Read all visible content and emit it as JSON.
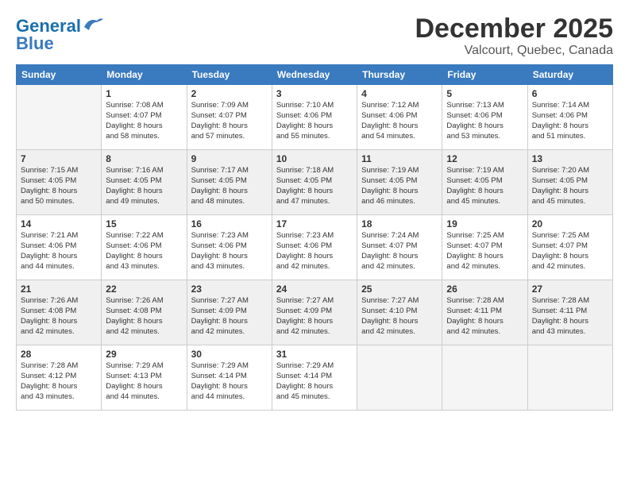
{
  "header": {
    "logo_line1": "General",
    "logo_line2": "Blue",
    "month": "December 2025",
    "location": "Valcourt, Quebec, Canada"
  },
  "days_of_week": [
    "Sunday",
    "Monday",
    "Tuesday",
    "Wednesday",
    "Thursday",
    "Friday",
    "Saturday"
  ],
  "weeks": [
    [
      {
        "day": "",
        "info": ""
      },
      {
        "day": "1",
        "info": "Sunrise: 7:08 AM\nSunset: 4:07 PM\nDaylight: 8 hours\nand 58 minutes."
      },
      {
        "day": "2",
        "info": "Sunrise: 7:09 AM\nSunset: 4:07 PM\nDaylight: 8 hours\nand 57 minutes."
      },
      {
        "day": "3",
        "info": "Sunrise: 7:10 AM\nSunset: 4:06 PM\nDaylight: 8 hours\nand 55 minutes."
      },
      {
        "day": "4",
        "info": "Sunrise: 7:12 AM\nSunset: 4:06 PM\nDaylight: 8 hours\nand 54 minutes."
      },
      {
        "day": "5",
        "info": "Sunrise: 7:13 AM\nSunset: 4:06 PM\nDaylight: 8 hours\nand 53 minutes."
      },
      {
        "day": "6",
        "info": "Sunrise: 7:14 AM\nSunset: 4:06 PM\nDaylight: 8 hours\nand 51 minutes."
      }
    ],
    [
      {
        "day": "7",
        "info": "Sunrise: 7:15 AM\nSunset: 4:05 PM\nDaylight: 8 hours\nand 50 minutes."
      },
      {
        "day": "8",
        "info": "Sunrise: 7:16 AM\nSunset: 4:05 PM\nDaylight: 8 hours\nand 49 minutes."
      },
      {
        "day": "9",
        "info": "Sunrise: 7:17 AM\nSunset: 4:05 PM\nDaylight: 8 hours\nand 48 minutes."
      },
      {
        "day": "10",
        "info": "Sunrise: 7:18 AM\nSunset: 4:05 PM\nDaylight: 8 hours\nand 47 minutes."
      },
      {
        "day": "11",
        "info": "Sunrise: 7:19 AM\nSunset: 4:05 PM\nDaylight: 8 hours\nand 46 minutes."
      },
      {
        "day": "12",
        "info": "Sunrise: 7:19 AM\nSunset: 4:05 PM\nDaylight: 8 hours\nand 45 minutes."
      },
      {
        "day": "13",
        "info": "Sunrise: 7:20 AM\nSunset: 4:05 PM\nDaylight: 8 hours\nand 45 minutes."
      }
    ],
    [
      {
        "day": "14",
        "info": "Sunrise: 7:21 AM\nSunset: 4:06 PM\nDaylight: 8 hours\nand 44 minutes."
      },
      {
        "day": "15",
        "info": "Sunrise: 7:22 AM\nSunset: 4:06 PM\nDaylight: 8 hours\nand 43 minutes."
      },
      {
        "day": "16",
        "info": "Sunrise: 7:23 AM\nSunset: 4:06 PM\nDaylight: 8 hours\nand 43 minutes."
      },
      {
        "day": "17",
        "info": "Sunrise: 7:23 AM\nSunset: 4:06 PM\nDaylight: 8 hours\nand 42 minutes."
      },
      {
        "day": "18",
        "info": "Sunrise: 7:24 AM\nSunset: 4:07 PM\nDaylight: 8 hours\nand 42 minutes."
      },
      {
        "day": "19",
        "info": "Sunrise: 7:25 AM\nSunset: 4:07 PM\nDaylight: 8 hours\nand 42 minutes."
      },
      {
        "day": "20",
        "info": "Sunrise: 7:25 AM\nSunset: 4:07 PM\nDaylight: 8 hours\nand 42 minutes."
      }
    ],
    [
      {
        "day": "21",
        "info": "Sunrise: 7:26 AM\nSunset: 4:08 PM\nDaylight: 8 hours\nand 42 minutes."
      },
      {
        "day": "22",
        "info": "Sunrise: 7:26 AM\nSunset: 4:08 PM\nDaylight: 8 hours\nand 42 minutes."
      },
      {
        "day": "23",
        "info": "Sunrise: 7:27 AM\nSunset: 4:09 PM\nDaylight: 8 hours\nand 42 minutes."
      },
      {
        "day": "24",
        "info": "Sunrise: 7:27 AM\nSunset: 4:09 PM\nDaylight: 8 hours\nand 42 minutes."
      },
      {
        "day": "25",
        "info": "Sunrise: 7:27 AM\nSunset: 4:10 PM\nDaylight: 8 hours\nand 42 minutes."
      },
      {
        "day": "26",
        "info": "Sunrise: 7:28 AM\nSunset: 4:11 PM\nDaylight: 8 hours\nand 42 minutes."
      },
      {
        "day": "27",
        "info": "Sunrise: 7:28 AM\nSunset: 4:11 PM\nDaylight: 8 hours\nand 43 minutes."
      }
    ],
    [
      {
        "day": "28",
        "info": "Sunrise: 7:28 AM\nSunset: 4:12 PM\nDaylight: 8 hours\nand 43 minutes."
      },
      {
        "day": "29",
        "info": "Sunrise: 7:29 AM\nSunset: 4:13 PM\nDaylight: 8 hours\nand 44 minutes."
      },
      {
        "day": "30",
        "info": "Sunrise: 7:29 AM\nSunset: 4:14 PM\nDaylight: 8 hours\nand 44 minutes."
      },
      {
        "day": "31",
        "info": "Sunrise: 7:29 AM\nSunset: 4:14 PM\nDaylight: 8 hours\nand 45 minutes."
      },
      {
        "day": "",
        "info": ""
      },
      {
        "day": "",
        "info": ""
      },
      {
        "day": "",
        "info": ""
      }
    ]
  ]
}
